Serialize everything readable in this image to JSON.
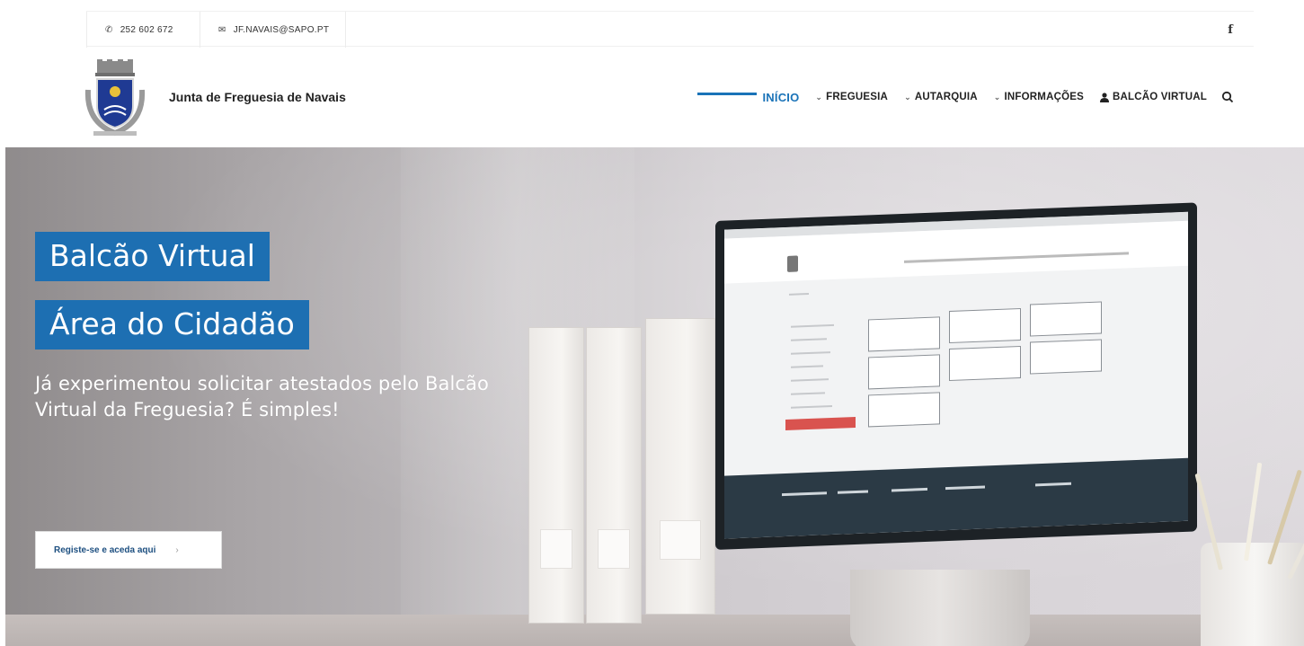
{
  "topbar": {
    "phone": "252 602 672",
    "email": "JF.NAVAIS@SAPO.PT",
    "facebook_glyph": "f"
  },
  "header": {
    "site_title": "Junta de Freguesia de Navais",
    "nav": {
      "inicio": "INÍCIO",
      "freguesia": "FREGUESIA",
      "autarquia": "AUTARQUIA",
      "informacoes": "INFORMAÇÕES",
      "balcao": "BALCÃO VIRTUAL"
    }
  },
  "hero": {
    "title1": "Balcão Virtual",
    "title2": "Área do Cidadão",
    "lead": "Já experimentou solicitar atestados pelo Balcão Virtual da Freguesia? É simples!",
    "cta": "Registe-se e aceda aqui",
    "cta_arrow": "›"
  },
  "icons": {
    "phone": "phone-icon",
    "email": "envelope-icon",
    "facebook": "facebook-icon",
    "search": "search-icon",
    "user": "user-icon",
    "caret": "chevron-down-icon"
  },
  "colors": {
    "accent": "#1a73b8",
    "tag_bg": "#1d6fb2"
  }
}
